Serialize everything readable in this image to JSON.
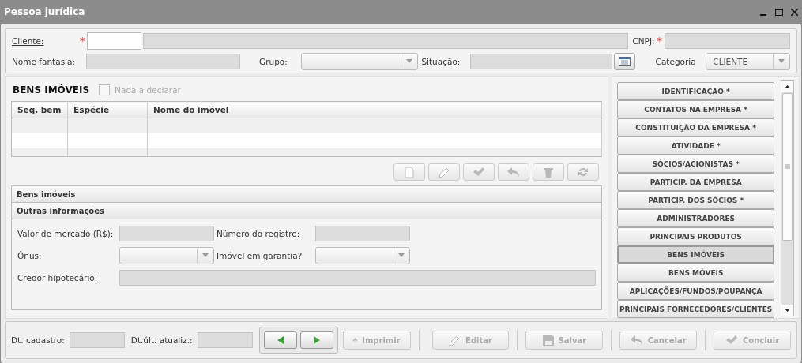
{
  "window": {
    "title": "Pessoa jurídica"
  },
  "header": {
    "cliente_label": "Cliente:",
    "required_mark": "*",
    "cnpj_label": "CNPJ:",
    "cnpj_required_mark": "*",
    "nome_fantasia_label": "Nome fantasia:",
    "grupo_label": "Grupo:",
    "situacao_label": "Situação:",
    "categoria_label": "Categoria",
    "categoria_value": "CLIENTE"
  },
  "section": {
    "title": "BENS IMÓVEIS",
    "nada_a_declarar": {
      "label": "Nada a declarar",
      "checked": false,
      "disabled": true
    }
  },
  "table": {
    "columns": [
      "Seq. bem",
      "Espécie",
      "Nome do imóvel"
    ]
  },
  "toolbar": [
    {
      "kind": "new",
      "disabled": true
    },
    {
      "kind": "edit",
      "disabled": true
    },
    {
      "kind": "confirm",
      "disabled": true
    },
    {
      "kind": "undo",
      "disabled": true
    },
    {
      "kind": "delete",
      "disabled": true
    },
    {
      "kind": "refresh",
      "disabled": true
    }
  ],
  "panels": [
    {
      "title": "Bens imóveis"
    },
    {
      "title": "Outras informações"
    }
  ],
  "form": {
    "valor_label": "Valor de mercado (R$):",
    "numero_label": "Número do registro:",
    "onus_label": "Ônus:",
    "garantia_label": "Imóvel em garantia?",
    "credor_label": "Credor hipotecário:"
  },
  "side_menu": [
    {
      "label": "IDENTIFICAÇÃO *",
      "selected": false
    },
    {
      "label": "CONTATOS NA EMPRESA *",
      "selected": false
    },
    {
      "label": "CONSTITUIÇÃO DA EMPRESA *",
      "selected": false
    },
    {
      "label": "ATIVIDADE *",
      "selected": false
    },
    {
      "label": "SÓCIOS/ACIONISTAS *",
      "selected": false
    },
    {
      "label": "PARTICIP. DA EMPRESA",
      "selected": false
    },
    {
      "label": "PARTICIP. DOS SÓCIOS *",
      "selected": false
    },
    {
      "label": "ADMINISTRADORES",
      "selected": false
    },
    {
      "label": "PRINCIPAIS PRODUTOS",
      "selected": false
    },
    {
      "label": "BENS IMÓVEIS",
      "selected": true
    },
    {
      "label": "BENS MÓVEIS",
      "selected": false
    },
    {
      "label": "APLICAÇÕES/FUNDOS/POUPANÇA",
      "selected": false
    },
    {
      "label": "PRINCIPAIS FORNECEDORES/CLIENTES",
      "selected": false
    }
  ],
  "footer": {
    "cadastro_label": "Dt. cadastro:",
    "atualiz_label": "Dt.últ. atualiz.:",
    "buttons": [
      {
        "kind": "print",
        "label": "Imprimir",
        "disabled": true
      },
      {
        "kind": "edit",
        "label": "Editar",
        "disabled": true
      },
      {
        "kind": "save",
        "label": "Salvar",
        "disabled": true
      },
      {
        "kind": "cancel",
        "label": "Cancelar",
        "disabled": true
      },
      {
        "kind": "conclude",
        "label": "Concluir",
        "disabled": true
      }
    ]
  }
}
